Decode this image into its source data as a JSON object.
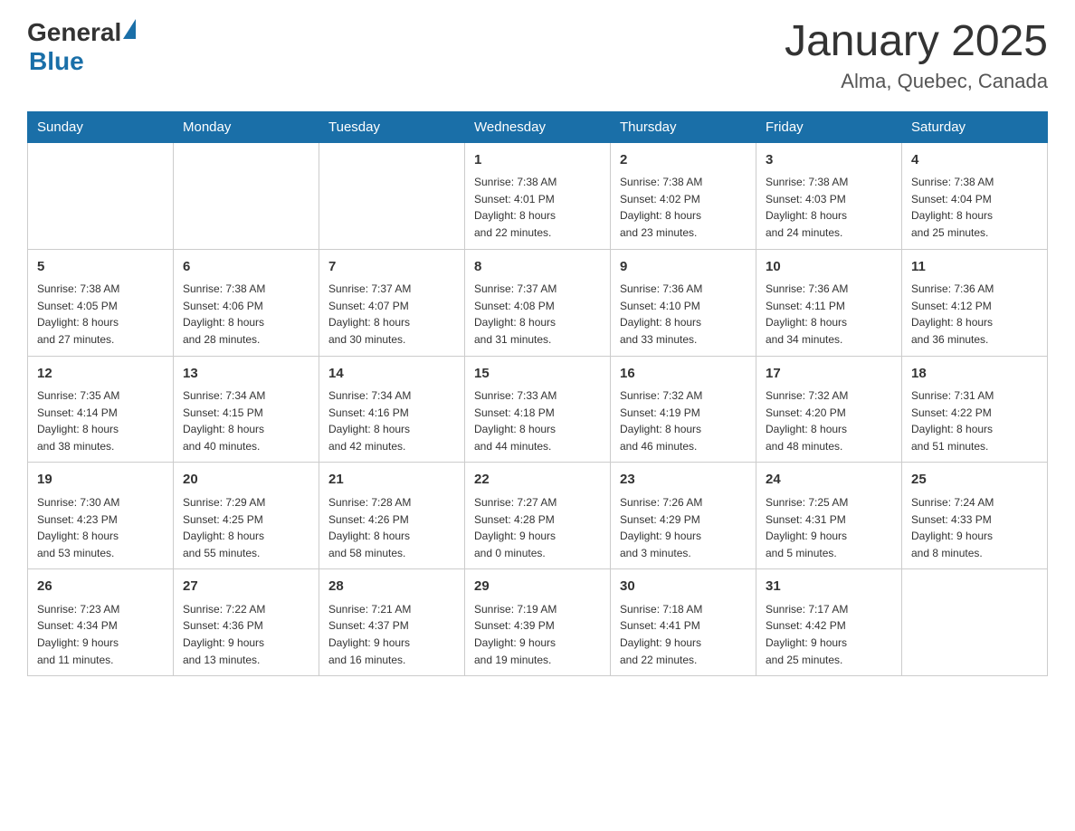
{
  "header": {
    "logo_general": "General",
    "logo_blue": "Blue",
    "title": "January 2025",
    "subtitle": "Alma, Quebec, Canada"
  },
  "columns": [
    "Sunday",
    "Monday",
    "Tuesday",
    "Wednesday",
    "Thursday",
    "Friday",
    "Saturday"
  ],
  "weeks": [
    [
      {
        "day": "",
        "info": ""
      },
      {
        "day": "",
        "info": ""
      },
      {
        "day": "",
        "info": ""
      },
      {
        "day": "1",
        "info": "Sunrise: 7:38 AM\nSunset: 4:01 PM\nDaylight: 8 hours\nand 22 minutes."
      },
      {
        "day": "2",
        "info": "Sunrise: 7:38 AM\nSunset: 4:02 PM\nDaylight: 8 hours\nand 23 minutes."
      },
      {
        "day": "3",
        "info": "Sunrise: 7:38 AM\nSunset: 4:03 PM\nDaylight: 8 hours\nand 24 minutes."
      },
      {
        "day": "4",
        "info": "Sunrise: 7:38 AM\nSunset: 4:04 PM\nDaylight: 8 hours\nand 25 minutes."
      }
    ],
    [
      {
        "day": "5",
        "info": "Sunrise: 7:38 AM\nSunset: 4:05 PM\nDaylight: 8 hours\nand 27 minutes."
      },
      {
        "day": "6",
        "info": "Sunrise: 7:38 AM\nSunset: 4:06 PM\nDaylight: 8 hours\nand 28 minutes."
      },
      {
        "day": "7",
        "info": "Sunrise: 7:37 AM\nSunset: 4:07 PM\nDaylight: 8 hours\nand 30 minutes."
      },
      {
        "day": "8",
        "info": "Sunrise: 7:37 AM\nSunset: 4:08 PM\nDaylight: 8 hours\nand 31 minutes."
      },
      {
        "day": "9",
        "info": "Sunrise: 7:36 AM\nSunset: 4:10 PM\nDaylight: 8 hours\nand 33 minutes."
      },
      {
        "day": "10",
        "info": "Sunrise: 7:36 AM\nSunset: 4:11 PM\nDaylight: 8 hours\nand 34 minutes."
      },
      {
        "day": "11",
        "info": "Sunrise: 7:36 AM\nSunset: 4:12 PM\nDaylight: 8 hours\nand 36 minutes."
      }
    ],
    [
      {
        "day": "12",
        "info": "Sunrise: 7:35 AM\nSunset: 4:14 PM\nDaylight: 8 hours\nand 38 minutes."
      },
      {
        "day": "13",
        "info": "Sunrise: 7:34 AM\nSunset: 4:15 PM\nDaylight: 8 hours\nand 40 minutes."
      },
      {
        "day": "14",
        "info": "Sunrise: 7:34 AM\nSunset: 4:16 PM\nDaylight: 8 hours\nand 42 minutes."
      },
      {
        "day": "15",
        "info": "Sunrise: 7:33 AM\nSunset: 4:18 PM\nDaylight: 8 hours\nand 44 minutes."
      },
      {
        "day": "16",
        "info": "Sunrise: 7:32 AM\nSunset: 4:19 PM\nDaylight: 8 hours\nand 46 minutes."
      },
      {
        "day": "17",
        "info": "Sunrise: 7:32 AM\nSunset: 4:20 PM\nDaylight: 8 hours\nand 48 minutes."
      },
      {
        "day": "18",
        "info": "Sunrise: 7:31 AM\nSunset: 4:22 PM\nDaylight: 8 hours\nand 51 minutes."
      }
    ],
    [
      {
        "day": "19",
        "info": "Sunrise: 7:30 AM\nSunset: 4:23 PM\nDaylight: 8 hours\nand 53 minutes."
      },
      {
        "day": "20",
        "info": "Sunrise: 7:29 AM\nSunset: 4:25 PM\nDaylight: 8 hours\nand 55 minutes."
      },
      {
        "day": "21",
        "info": "Sunrise: 7:28 AM\nSunset: 4:26 PM\nDaylight: 8 hours\nand 58 minutes."
      },
      {
        "day": "22",
        "info": "Sunrise: 7:27 AM\nSunset: 4:28 PM\nDaylight: 9 hours\nand 0 minutes."
      },
      {
        "day": "23",
        "info": "Sunrise: 7:26 AM\nSunset: 4:29 PM\nDaylight: 9 hours\nand 3 minutes."
      },
      {
        "day": "24",
        "info": "Sunrise: 7:25 AM\nSunset: 4:31 PM\nDaylight: 9 hours\nand 5 minutes."
      },
      {
        "day": "25",
        "info": "Sunrise: 7:24 AM\nSunset: 4:33 PM\nDaylight: 9 hours\nand 8 minutes."
      }
    ],
    [
      {
        "day": "26",
        "info": "Sunrise: 7:23 AM\nSunset: 4:34 PM\nDaylight: 9 hours\nand 11 minutes."
      },
      {
        "day": "27",
        "info": "Sunrise: 7:22 AM\nSunset: 4:36 PM\nDaylight: 9 hours\nand 13 minutes."
      },
      {
        "day": "28",
        "info": "Sunrise: 7:21 AM\nSunset: 4:37 PM\nDaylight: 9 hours\nand 16 minutes."
      },
      {
        "day": "29",
        "info": "Sunrise: 7:19 AM\nSunset: 4:39 PM\nDaylight: 9 hours\nand 19 minutes."
      },
      {
        "day": "30",
        "info": "Sunrise: 7:18 AM\nSunset: 4:41 PM\nDaylight: 9 hours\nand 22 minutes."
      },
      {
        "day": "31",
        "info": "Sunrise: 7:17 AM\nSunset: 4:42 PM\nDaylight: 9 hours\nand 25 minutes."
      },
      {
        "day": "",
        "info": ""
      }
    ]
  ]
}
